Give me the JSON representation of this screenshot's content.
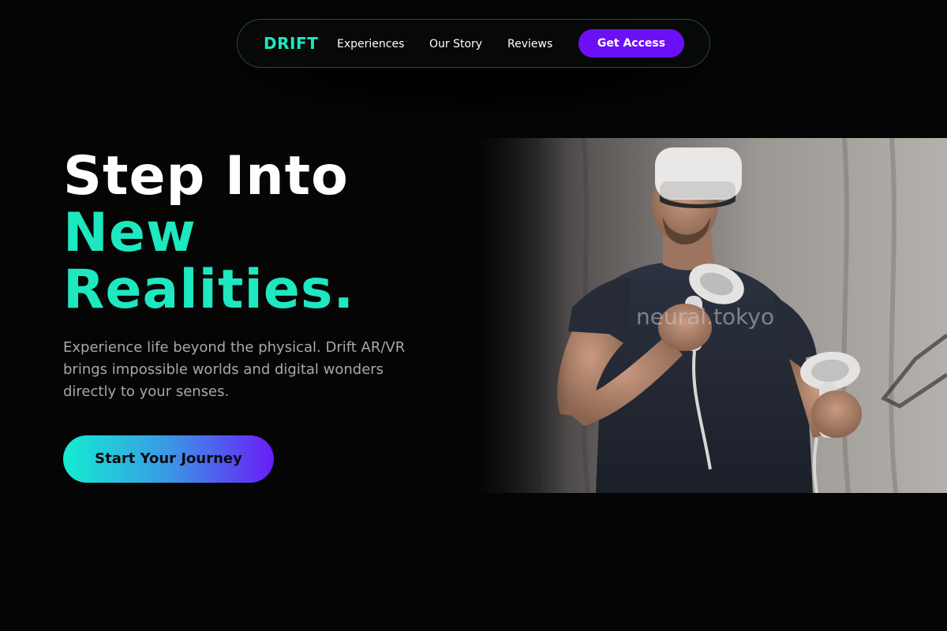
{
  "nav": {
    "logo": "DRIFT",
    "links": [
      "Experiences",
      "Our Story",
      "Reviews"
    ],
    "cta_label": "Get Access"
  },
  "hero": {
    "title_line1": "Step Into",
    "title_accent_line1": "New",
    "title_accent_line2": "Realities.",
    "description": "Experience life beyond the physical. Drift AR/VR brings impossible worlds and digital wonders directly to your senses.",
    "cta_label": "Start Your Journey"
  },
  "image": {
    "subject": "man-wearing-vr-headset-with-controllers",
    "watermark": "neural.tokyo"
  },
  "colors": {
    "background": "#050505",
    "accent": "#1de8c0",
    "purple": "#6b0ff5"
  }
}
